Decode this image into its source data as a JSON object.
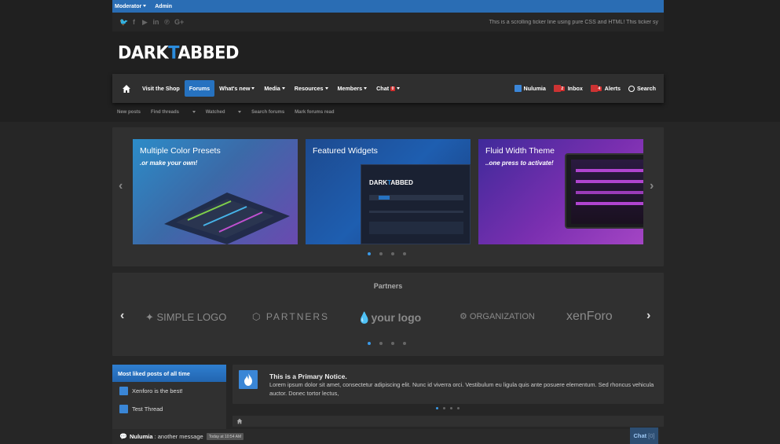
{
  "staff_bar": {
    "items": [
      "Moderator",
      "Admin"
    ]
  },
  "social": [
    "twitter-icon",
    "facebook-icon",
    "youtube-icon",
    "linkedin-icon",
    "pinterest-icon",
    "googleplus-icon"
  ],
  "ticker": "This is a scrolling ticker line using pure CSS and HTML! This ticker sy",
  "logo": {
    "part1": "DARK",
    "accent": "T",
    "part2": "ABBED"
  },
  "nav": {
    "tabs": [
      {
        "label": "Visit the Shop",
        "dropdown": false,
        "active": false
      },
      {
        "label": "Forums",
        "dropdown": false,
        "active": true
      },
      {
        "label": "What's new",
        "dropdown": true,
        "active": false
      },
      {
        "label": "Media",
        "dropdown": true,
        "active": false
      },
      {
        "label": "Resources",
        "dropdown": true,
        "active": false
      },
      {
        "label": "Members",
        "dropdown": true,
        "active": false
      },
      {
        "label": "Chat",
        "dropdown": true,
        "active": false,
        "badge": "0"
      }
    ],
    "user": "Nulumia",
    "inbox": "Inbox",
    "inbox_badge": "2",
    "alerts": "Alerts",
    "alerts_badge": "4",
    "search": "Search"
  },
  "subnav": [
    "New posts",
    "Find threads",
    "Watched",
    "Search forums",
    "Mark forums read"
  ],
  "slider": {
    "slides": [
      {
        "title": "Multiple Color Presets",
        "subtitle": ".or make your own!"
      },
      {
        "title": "Featured Widgets",
        "subtitle": ""
      },
      {
        "title": "Fluid Width Theme",
        "subtitle": "..one press to activate!"
      }
    ],
    "dots": 4,
    "active_dot": 0
  },
  "partners": {
    "title": "Partners",
    "logos": [
      "SIMPLE LOGO",
      "PARTNERS",
      "your logo",
      "ORGANIZATION",
      "xenForo"
    ],
    "dots": 4,
    "active_dot": 0
  },
  "sidebar": {
    "title": "Most liked posts of all time",
    "items": [
      "Xenforo is the best!",
      "Test Thread"
    ]
  },
  "notice": {
    "title": "This is a Primary Notice.",
    "text": "Lorem ipsum dolor sit amet, consectetur adipiscing elit. Nunc id viverra orci. Vestibulum eu ligula quis ante posuere elementum. Sed rhoncus vehicula auctor. Donec tortor lectus,"
  },
  "chat": {
    "user": "Nulumia",
    "message": "another message",
    "time": "Today at 10:54 AM",
    "button": "Chat",
    "count": "[0]"
  },
  "colors": {
    "accent": "#2672c0",
    "staff_bar": "#2a6db4",
    "badge": "#d32f2f"
  }
}
